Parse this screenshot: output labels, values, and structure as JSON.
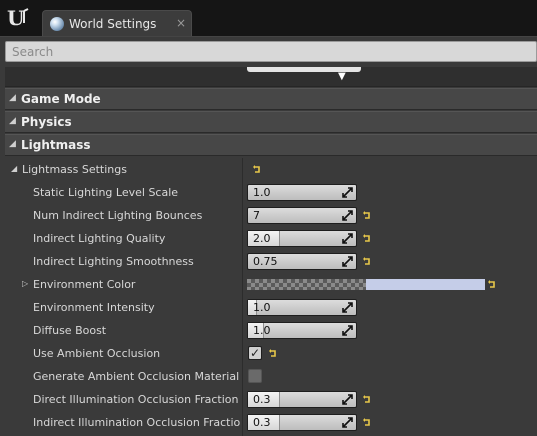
{
  "tab": {
    "title": "World Settings",
    "close": "×"
  },
  "search": {
    "placeholder": "Search"
  },
  "categories": [
    {
      "label": "Game Mode",
      "expanded": false
    },
    {
      "label": "Physics",
      "expanded": false
    },
    {
      "label": "Lightmass",
      "expanded": true
    }
  ],
  "lightmass": {
    "subcategory": "Lightmass Settings",
    "properties": [
      {
        "label": "Static Lighting Level Scale",
        "type": "number",
        "value": "1.0",
        "fill": 0.0,
        "reset": false
      },
      {
        "label": "Num Indirect Lighting Bounces",
        "type": "number",
        "value": "7",
        "fill": 0.0,
        "reset": true
      },
      {
        "label": "Indirect Lighting Quality",
        "type": "number",
        "value": "2.0",
        "fill": 0.3,
        "reset": true
      },
      {
        "label": "Indirect Lighting Smoothness",
        "type": "number",
        "value": "0.75",
        "fill": 0.0,
        "reset": true
      },
      {
        "label": "Environment Color",
        "type": "color",
        "reset": true
      },
      {
        "label": "Environment Intensity",
        "type": "number",
        "value": "1.0",
        "fill": 0.08,
        "reset": false
      },
      {
        "label": "Diffuse Boost",
        "type": "number",
        "value": "1.0",
        "fill": 0.15,
        "reset": false
      },
      {
        "label": "Use Ambient Occlusion",
        "type": "checkbox",
        "checked": true,
        "reset": true
      },
      {
        "label": "Generate Ambient Occlusion Material Ma",
        "type": "checkbox",
        "checked": false,
        "reset": false
      },
      {
        "label": "Direct Illumination Occlusion Fraction",
        "type": "number",
        "value": "0.3",
        "fill": 0.3,
        "reset": true
      },
      {
        "label": "Indirect Illumination Occlusion Fraction",
        "type": "number",
        "value": "0.3",
        "fill": 0.3,
        "reset": true
      }
    ]
  },
  "colors": {
    "environment_color": "#c5cde8",
    "reset_arrow": "#e8c84a",
    "panel_bg": "#3a3a3a",
    "header_bg": "#474747"
  }
}
